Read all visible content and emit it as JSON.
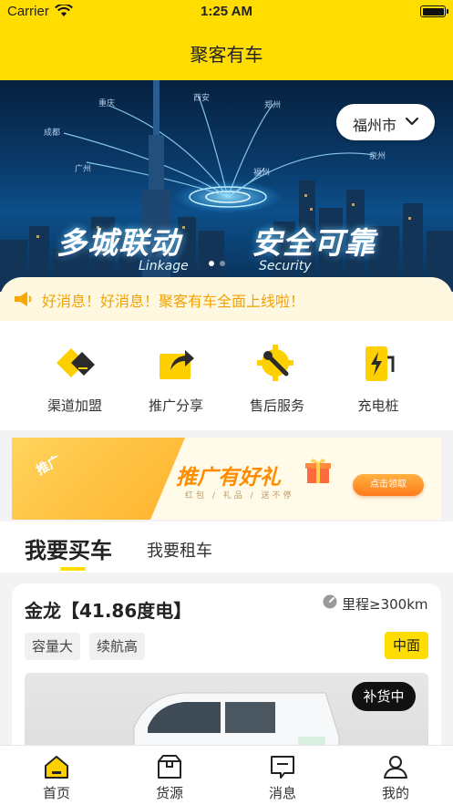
{
  "status_bar": {
    "carrier": "Carrier",
    "time": "1:25 AM"
  },
  "nav": {
    "title": "聚客有车"
  },
  "banner": {
    "headline_left": "多城联动",
    "headline_right": "安全可靠",
    "sub_left": "Linkage",
    "sub_right": "Security",
    "cities": [
      "重庆",
      "西安",
      "郑州",
      "成都",
      "广州",
      "福州",
      "泉州"
    ],
    "slide_count": 2,
    "active_slide": 1
  },
  "city_selector": {
    "label": "福州市"
  },
  "notice": {
    "text": "好消息！好消息！聚客有车全面上线啦！"
  },
  "quick_menu": [
    {
      "label": "渠道加盟",
      "icon": "channel-join-icon"
    },
    {
      "label": "推广分享",
      "icon": "share-icon"
    },
    {
      "label": "售后服务",
      "icon": "after-sales-icon"
    },
    {
      "label": "充电桩",
      "icon": "charging-pile-icon"
    }
  ],
  "promo": {
    "left_tag": "推广",
    "title": "推广有好礼",
    "subtitle": "红包 / 礼品 / 送不停",
    "button": "点击领取"
  },
  "tabs": {
    "buy": "我要买车",
    "rent": "我要租车",
    "active": "buy"
  },
  "car_card": {
    "name": "金龙【41.86度电】",
    "range": "里程≥300km",
    "tags": [
      "容量大",
      "续航高"
    ],
    "size": "中面",
    "stock_status": "补货中"
  },
  "tab_bar": [
    {
      "label": "首页",
      "icon": "home-icon"
    },
    {
      "label": "货源",
      "icon": "cargo-box-icon"
    },
    {
      "label": "消息",
      "icon": "message-icon"
    },
    {
      "label": "我的",
      "icon": "profile-icon"
    }
  ],
  "colors": {
    "brand_yellow": "#ffdd00",
    "notice_orange": "#f2a200",
    "promo_orange": "#ff8c00"
  }
}
